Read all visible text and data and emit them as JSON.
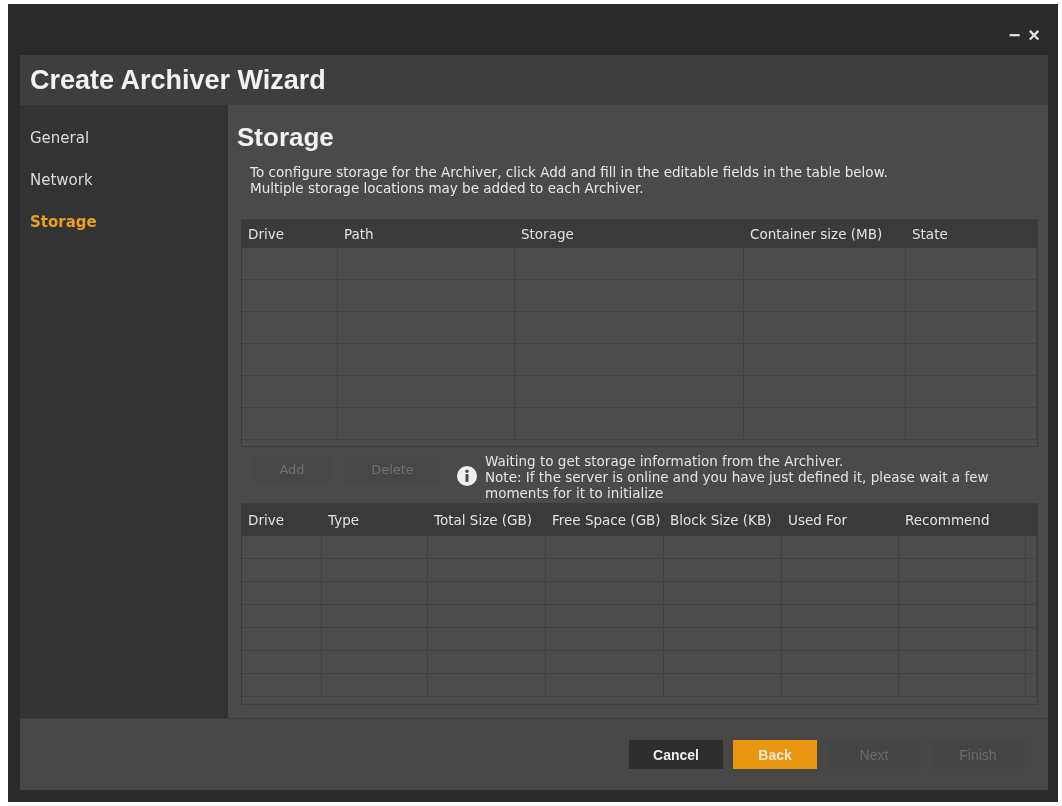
{
  "window": {
    "controls": [
      {
        "label": "−"
      },
      {
        "label": "×"
      }
    ],
    "title": "Create Archiver Wizard"
  },
  "sidebar": {
    "items": [
      {
        "label": "General",
        "selected": false
      },
      {
        "label": "Network",
        "selected": false
      },
      {
        "label": "Storage",
        "selected": true
      }
    ]
  },
  "page": {
    "heading": "Storage",
    "description": [
      "To configure storage for the Archiver, click Add and fill in the editable fields in the table below.",
      "Multiple storage locations may be added to each Archiver."
    ]
  },
  "storage_table": {
    "columns": [
      "Drive",
      "Path",
      "Storage",
      "Container size (MB)",
      "State"
    ]
  },
  "actions": [
    {
      "label": "Add",
      "disabled": true
    },
    {
      "label": "Delete",
      "disabled": true
    }
  ],
  "info": {
    "status": "Waiting to get storage information from the Archiver.",
    "note": "Note: If the server is online and you have just defined it, please wait a few moments for it to initialize"
  },
  "drives_table": {
    "columns": [
      "Drive",
      "Type",
      "Total Size (GB)",
      "Free Space (GB)",
      "Block Size (KB)",
      "Used For",
      "Recommend"
    ]
  },
  "footer": {
    "buttons": [
      {
        "label": "Cancel",
        "primary": false,
        "disabled": false
      },
      {
        "label": "Back",
        "primary": true,
        "disabled": false
      },
      {
        "label": "Next",
        "primary": false,
        "disabled": true
      },
      {
        "label": "Finish",
        "primary": false,
        "disabled": true
      }
    ]
  }
}
